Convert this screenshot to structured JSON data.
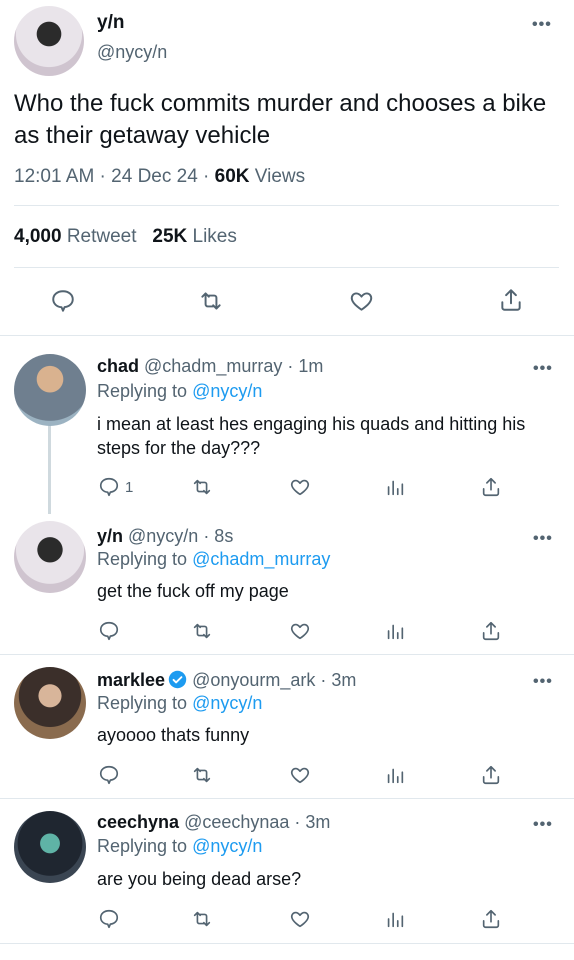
{
  "main_tweet": {
    "name": "y/n",
    "handle": "@nycy/n",
    "text": "Who the fuck commits murder and chooses a bike as their getaway vehicle",
    "time": "12:01 AM · 24 Dec 24 · ",
    "views_count": "60K",
    "views_label": " Views",
    "retweets_count": "4,000",
    "retweets_label": " Retweet",
    "likes_count": "25K",
    "likes_label": " Likes",
    "more": "•••"
  },
  "replies": [
    {
      "name": "chad",
      "handle": " @chadm_murray",
      "time": " · 1m",
      "replying_label": "Replying to ",
      "replying_to": "@nycy/n",
      "text": "i mean at least hes engaging his quads and hitting his steps for the day???",
      "reply_count": "1",
      "more": "•••"
    },
    {
      "name": "y/n",
      "handle": " @nycy/n",
      "time": " · 8s",
      "replying_label": "Replying to ",
      "replying_to": "@chadm_murray",
      "text": "get the fuck off my page",
      "more": "•••"
    },
    {
      "name": "marklee",
      "handle": " @onyourm_ark",
      "time": " · 3m",
      "replying_label": "Replying to ",
      "replying_to": "@nycy/n",
      "text": "ayoooo thats funny",
      "more": "•••"
    },
    {
      "name": "ceechyna",
      "handle": " @ceechynaa",
      "time": " · 3m",
      "replying_label": "Replying to ",
      "replying_to": "@nycy/n",
      "text": "are you being dead arse?",
      "more": "•••"
    }
  ],
  "icons": [
    "reply-icon",
    "retweet-icon",
    "like-icon",
    "share-icon",
    "analytics-icon",
    "verified-icon"
  ],
  "colors": {
    "link": "#1d9bf0",
    "muted": "#536471",
    "divider": "#e1e8ed"
  }
}
